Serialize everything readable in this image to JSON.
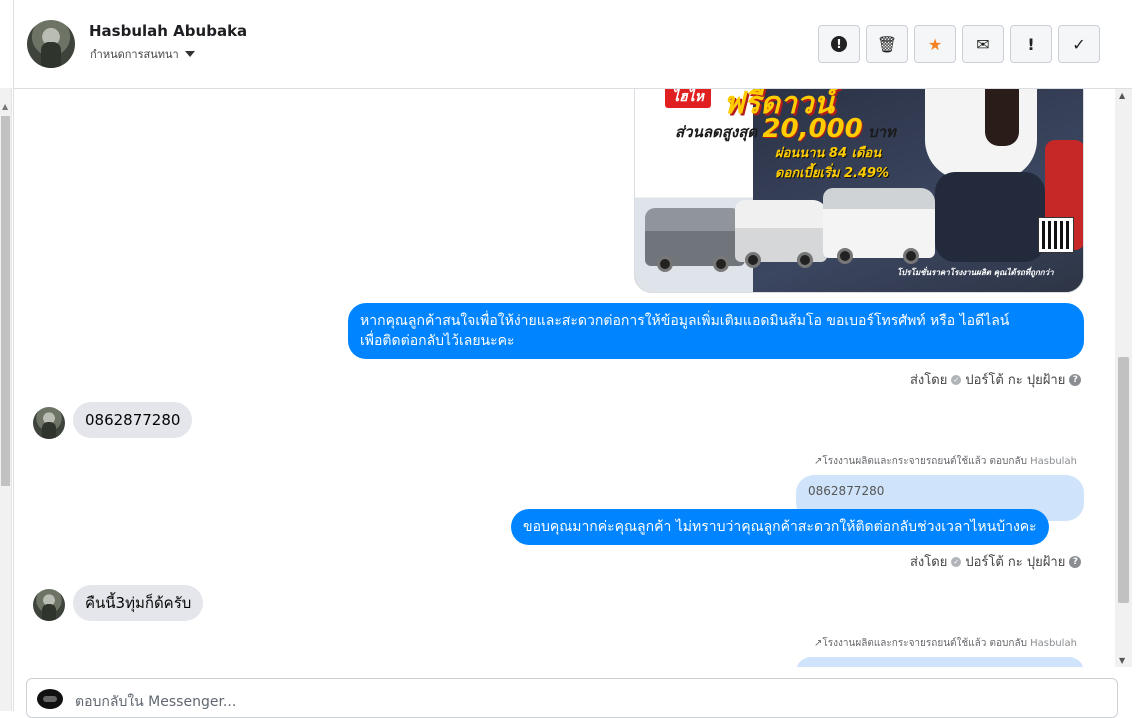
{
  "header": {
    "name": "Hasbulah Abubaka",
    "subtitle": "กำหนดการสนทนา",
    "tools": [
      {
        "icon": "!",
        "name": "spam"
      },
      {
        "icon": "🗑",
        "name": "trash"
      },
      {
        "icon": "★",
        "name": "star"
      },
      {
        "icon": "✉",
        "name": "mail"
      },
      {
        "icon": "!",
        "name": "important"
      },
      {
        "icon": "✓",
        "name": "done"
      }
    ]
  },
  "promo": {
    "badge": "ไฮไห",
    "headline": "ฟรีดาวน์",
    "discount_prefix": "ส่วนลดสูงสุด",
    "discount_value": "20,000",
    "discount_unit": "บาท",
    "installment": "ผ่อนนาน 84 เดือน",
    "interest": "ดอกเบี้ยเริ่ม 2.49%",
    "footer": "โปรโมชั่นราคาโรงงานผลิต คุณได้รถที่ถูกกว่า"
  },
  "messages": {
    "m1": "หากคุณลูกค้าสนใจเพื่อให้ง่ายและสะดวกต่อการให้ข้อมูลเพิ่มเติมแอดมินส้มโอ ขอเบอร์โทรศัพท์ หรือ ไอดีไลน์",
    "m1b": "เพื่อติดต่อกลับไว้เลยนะคะ",
    "meta1": "ส่งโดย",
    "meta1_name": "ปอร์โต้ กะ ปุยฝ้าย",
    "in1": "0862877280",
    "reply_note1": "โรงงานผลิตและกระจายรถยนต์ใช้แล้ว ตอบกลับ",
    "reply_note1_name": "Hasbulah",
    "quoted1": "0862877280",
    "m2": "ขอบคุณมากค่ะคุณลูกค้า ไม่ทราบว่าคุณลูกค้าสะดวกให้ติดต่อกลับช่วงเวลาไหนบ้างคะ",
    "meta2": "ส่งโดย",
    "meta2_name": "ปอร์โต้ กะ ปุยฝ้าย",
    "in2": "คืนนี้3ทุ่มก็ด้ครับ",
    "reply_note2": "โรงงานผลิตและกระจายรถยนต์ใช้แล้ว ตอบกลับ",
    "reply_note2_name": "Hasbulah"
  },
  "composer": {
    "placeholder": "ตอบกลับใน Messenger..."
  },
  "colors": {
    "outgoing": "#0084ff",
    "incoming": "#e4e6eb",
    "quoted": "#cfe4fb"
  }
}
